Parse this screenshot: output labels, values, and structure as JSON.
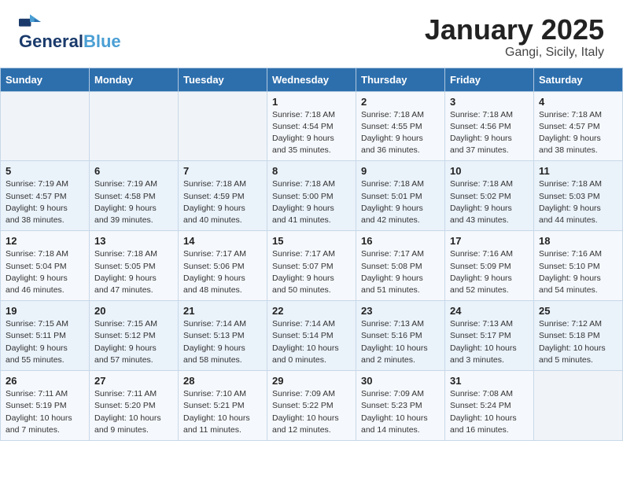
{
  "header": {
    "logo_general": "General",
    "logo_blue": "Blue",
    "title": "January 2025",
    "subtitle": "Gangi, Sicily, Italy"
  },
  "days_of_week": [
    "Sunday",
    "Monday",
    "Tuesday",
    "Wednesday",
    "Thursday",
    "Friday",
    "Saturday"
  ],
  "weeks": [
    [
      {
        "day": "",
        "detail": ""
      },
      {
        "day": "",
        "detail": ""
      },
      {
        "day": "",
        "detail": ""
      },
      {
        "day": "1",
        "detail": "Sunrise: 7:18 AM\nSunset: 4:54 PM\nDaylight: 9 hours\nand 35 minutes."
      },
      {
        "day": "2",
        "detail": "Sunrise: 7:18 AM\nSunset: 4:55 PM\nDaylight: 9 hours\nand 36 minutes."
      },
      {
        "day": "3",
        "detail": "Sunrise: 7:18 AM\nSunset: 4:56 PM\nDaylight: 9 hours\nand 37 minutes."
      },
      {
        "day": "4",
        "detail": "Sunrise: 7:18 AM\nSunset: 4:57 PM\nDaylight: 9 hours\nand 38 minutes."
      }
    ],
    [
      {
        "day": "5",
        "detail": "Sunrise: 7:19 AM\nSunset: 4:57 PM\nDaylight: 9 hours\nand 38 minutes."
      },
      {
        "day": "6",
        "detail": "Sunrise: 7:19 AM\nSunset: 4:58 PM\nDaylight: 9 hours\nand 39 minutes."
      },
      {
        "day": "7",
        "detail": "Sunrise: 7:18 AM\nSunset: 4:59 PM\nDaylight: 9 hours\nand 40 minutes."
      },
      {
        "day": "8",
        "detail": "Sunrise: 7:18 AM\nSunset: 5:00 PM\nDaylight: 9 hours\nand 41 minutes."
      },
      {
        "day": "9",
        "detail": "Sunrise: 7:18 AM\nSunset: 5:01 PM\nDaylight: 9 hours\nand 42 minutes."
      },
      {
        "day": "10",
        "detail": "Sunrise: 7:18 AM\nSunset: 5:02 PM\nDaylight: 9 hours\nand 43 minutes."
      },
      {
        "day": "11",
        "detail": "Sunrise: 7:18 AM\nSunset: 5:03 PM\nDaylight: 9 hours\nand 44 minutes."
      }
    ],
    [
      {
        "day": "12",
        "detail": "Sunrise: 7:18 AM\nSunset: 5:04 PM\nDaylight: 9 hours\nand 46 minutes."
      },
      {
        "day": "13",
        "detail": "Sunrise: 7:18 AM\nSunset: 5:05 PM\nDaylight: 9 hours\nand 47 minutes."
      },
      {
        "day": "14",
        "detail": "Sunrise: 7:17 AM\nSunset: 5:06 PM\nDaylight: 9 hours\nand 48 minutes."
      },
      {
        "day": "15",
        "detail": "Sunrise: 7:17 AM\nSunset: 5:07 PM\nDaylight: 9 hours\nand 50 minutes."
      },
      {
        "day": "16",
        "detail": "Sunrise: 7:17 AM\nSunset: 5:08 PM\nDaylight: 9 hours\nand 51 minutes."
      },
      {
        "day": "17",
        "detail": "Sunrise: 7:16 AM\nSunset: 5:09 PM\nDaylight: 9 hours\nand 52 minutes."
      },
      {
        "day": "18",
        "detail": "Sunrise: 7:16 AM\nSunset: 5:10 PM\nDaylight: 9 hours\nand 54 minutes."
      }
    ],
    [
      {
        "day": "19",
        "detail": "Sunrise: 7:15 AM\nSunset: 5:11 PM\nDaylight: 9 hours\nand 55 minutes."
      },
      {
        "day": "20",
        "detail": "Sunrise: 7:15 AM\nSunset: 5:12 PM\nDaylight: 9 hours\nand 57 minutes."
      },
      {
        "day": "21",
        "detail": "Sunrise: 7:14 AM\nSunset: 5:13 PM\nDaylight: 9 hours\nand 58 minutes."
      },
      {
        "day": "22",
        "detail": "Sunrise: 7:14 AM\nSunset: 5:14 PM\nDaylight: 10 hours\nand 0 minutes."
      },
      {
        "day": "23",
        "detail": "Sunrise: 7:13 AM\nSunset: 5:16 PM\nDaylight: 10 hours\nand 2 minutes."
      },
      {
        "day": "24",
        "detail": "Sunrise: 7:13 AM\nSunset: 5:17 PM\nDaylight: 10 hours\nand 3 minutes."
      },
      {
        "day": "25",
        "detail": "Sunrise: 7:12 AM\nSunset: 5:18 PM\nDaylight: 10 hours\nand 5 minutes."
      }
    ],
    [
      {
        "day": "26",
        "detail": "Sunrise: 7:11 AM\nSunset: 5:19 PM\nDaylight: 10 hours\nand 7 minutes."
      },
      {
        "day": "27",
        "detail": "Sunrise: 7:11 AM\nSunset: 5:20 PM\nDaylight: 10 hours\nand 9 minutes."
      },
      {
        "day": "28",
        "detail": "Sunrise: 7:10 AM\nSunset: 5:21 PM\nDaylight: 10 hours\nand 11 minutes."
      },
      {
        "day": "29",
        "detail": "Sunrise: 7:09 AM\nSunset: 5:22 PM\nDaylight: 10 hours\nand 12 minutes."
      },
      {
        "day": "30",
        "detail": "Sunrise: 7:09 AM\nSunset: 5:23 PM\nDaylight: 10 hours\nand 14 minutes."
      },
      {
        "day": "31",
        "detail": "Sunrise: 7:08 AM\nSunset: 5:24 PM\nDaylight: 10 hours\nand 16 minutes."
      },
      {
        "day": "",
        "detail": ""
      }
    ]
  ]
}
